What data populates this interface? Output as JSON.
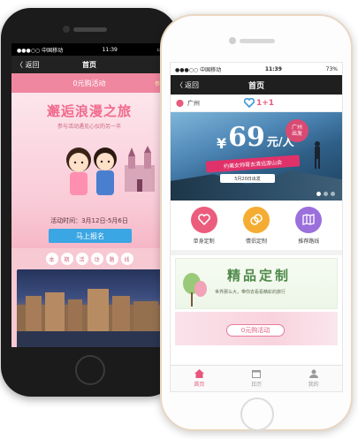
{
  "back_phone": {
    "status": {
      "carrier": "●●●○○ 中国移动",
      "time": "11:39",
      "battery": "▭"
    },
    "nav": {
      "back_label": "〈 返回",
      "title": "首页"
    },
    "banner": {
      "title": "0元购活动",
      "more": "参与"
    },
    "hero": {
      "headline": "邂逅浪漫之旅",
      "subline": "参与活动遇见心仪的另一半",
      "time_text": "活动时间：3月12日-5月6日",
      "signup_label": "马上报名"
    },
    "route_chars": [
      "本",
      "期",
      "活",
      "动",
      "路",
      "线"
    ]
  },
  "front_phone": {
    "status": {
      "carrier": "●●●○○ 中国移动",
      "time": "11:39",
      "battery": "73%"
    },
    "nav": {
      "back_label": "返回",
      "title": "首页"
    },
    "location": {
      "city": "广州",
      "brand": "1+1"
    },
    "banner": {
      "yen": "¥",
      "price": "69",
      "unit": "元/人",
      "city_badge_l1": "广州",
      "city_badge_l2": "出发",
      "slogan": "约美女帅哥去清远游山会",
      "date": "5月20日出发"
    },
    "quick_links": [
      {
        "label": "单身定制",
        "color": "#ec5c7c",
        "icon": "heart-icon"
      },
      {
        "label": "情侣定制",
        "color": "#f4ad32",
        "icon": "rings-icon"
      },
      {
        "label": "推荐路线",
        "color": "#9b6fdc",
        "icon": "map-icon"
      }
    ],
    "card1": {
      "title": "精品定制",
      "subtitle": "世界那么大，带你去看看精彩的旅行"
    },
    "card2": {
      "title": "0元购活动"
    },
    "tabbar": [
      {
        "label": "首页",
        "active": true
      },
      {
        "label": "日历",
        "active": false
      },
      {
        "label": "我的",
        "active": false
      }
    ]
  }
}
